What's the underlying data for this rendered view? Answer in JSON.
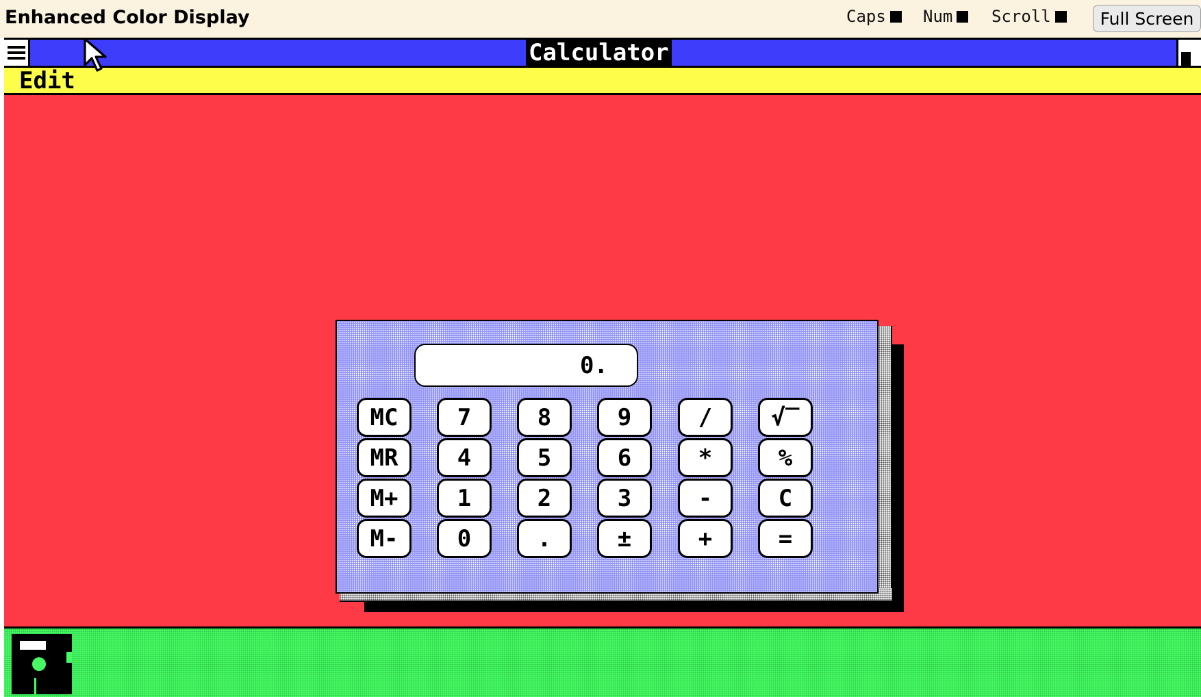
{
  "header": {
    "title": "Enhanced Color Display",
    "indicators": [
      {
        "label": "Caps"
      },
      {
        "label": "Num"
      },
      {
        "label": "Scroll"
      }
    ],
    "fullscreen_label": "Full Screen"
  },
  "window": {
    "title": "Calculator",
    "menu": {
      "edit": "Edit"
    }
  },
  "calculator": {
    "display": "0.",
    "buttons": [
      [
        "MC",
        "7",
        "8",
        "9",
        "/",
        "√‾"
      ],
      [
        "MR",
        "4",
        "5",
        "6",
        "*",
        "%"
      ],
      [
        "M+",
        "1",
        "2",
        "3",
        "-",
        "C"
      ],
      [
        "M-",
        "0",
        ".",
        "±",
        "+",
        "="
      ]
    ]
  },
  "taskbar": {
    "icons": [
      "floppy-disk-icon"
    ]
  },
  "colors": {
    "title_bar": "#3d3dfb",
    "menu_bar": "#fefe4a",
    "desktop": "#fd3a45",
    "taskbar": "#46fb63",
    "calculator_face": "#8f90f4"
  }
}
